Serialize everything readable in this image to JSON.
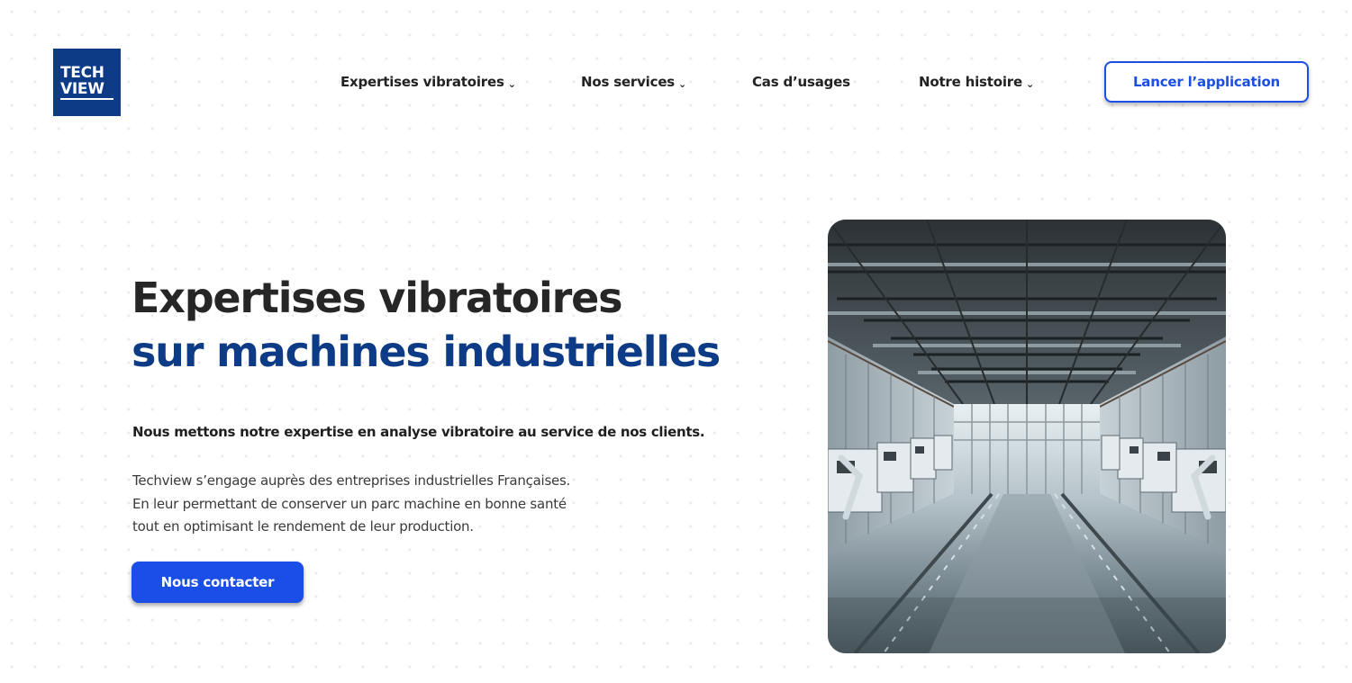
{
  "brand": {
    "logo_line1": "TECH",
    "logo_line2": "VIEW",
    "logo_color": "#0d3b86"
  },
  "nav": {
    "items": [
      {
        "label": "Expertises vibratoires",
        "has_dropdown": true
      },
      {
        "label": "Nos services",
        "has_dropdown": true
      },
      {
        "label": "Cas d’usages",
        "has_dropdown": false
      },
      {
        "label": "Notre histoire",
        "has_dropdown": true
      }
    ],
    "dropdown_glyph": "⌄",
    "cta_label": "Lancer l’application"
  },
  "hero": {
    "title_line1": "Expertises vibratoires",
    "title_line2": "sur machines industrielles",
    "lead": "Nous mettons notre expertise en analyse vibratoire au service de nos clients.",
    "body_lines": [
      "Techview s’engage auprès des entreprises industrielles Françaises.",
      "En leur permettant de conserver un parc machine en bonne santé",
      "tout en optimisant le rendement de leur production."
    ],
    "cta_label": "Nous contacter"
  },
  "image": {
    "subject": "industrial-factory-hall"
  },
  "colors": {
    "accent": "#1a4ee6",
    "title_dark": "#262626",
    "title_blue": "#0d3b86",
    "text": "#3a3a3a"
  }
}
